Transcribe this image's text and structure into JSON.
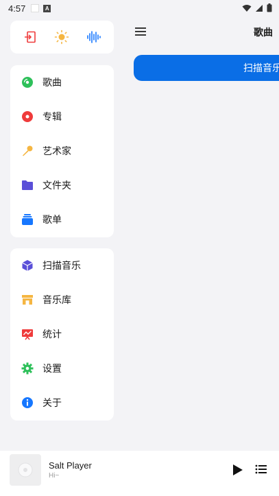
{
  "status": {
    "time": "4:57",
    "badge": "A"
  },
  "header": {
    "title": "歌曲"
  },
  "scan_button": {
    "label": "扫描音乐"
  },
  "top_actions": [
    {
      "icon": "exit-icon"
    },
    {
      "icon": "theme-sun-icon"
    },
    {
      "icon": "equalizer-icon"
    }
  ],
  "library_menu": [
    {
      "label": "歌曲",
      "icon": "disc-icon",
      "color": "#2ec05a"
    },
    {
      "label": "专辑",
      "icon": "album-icon",
      "color": "#ef3b3b"
    },
    {
      "label": "艺术家",
      "icon": "microphone-icon",
      "color": "#f5b642"
    },
    {
      "label": "文件夹",
      "icon": "folder-icon",
      "color": "#5a4fd8"
    },
    {
      "label": "歌单",
      "icon": "playlist-icon",
      "color": "#1677ff"
    }
  ],
  "tools_menu": [
    {
      "label": "扫描音乐",
      "icon": "scan-cube-icon",
      "color": "#5a4fd8"
    },
    {
      "label": "音乐库",
      "icon": "store-icon",
      "color": "#f5b642"
    },
    {
      "label": "统计",
      "icon": "stats-icon",
      "color": "#ef3b3b"
    },
    {
      "label": "设置",
      "icon": "gear-icon",
      "color": "#2ec05a"
    },
    {
      "label": "关于",
      "icon": "info-icon",
      "color": "#1677ff"
    }
  ],
  "player": {
    "title": "Salt Player",
    "subtitle": "Hi~"
  },
  "colors": {
    "accent": "#0a6ee6",
    "background": "#f3f3f6"
  }
}
